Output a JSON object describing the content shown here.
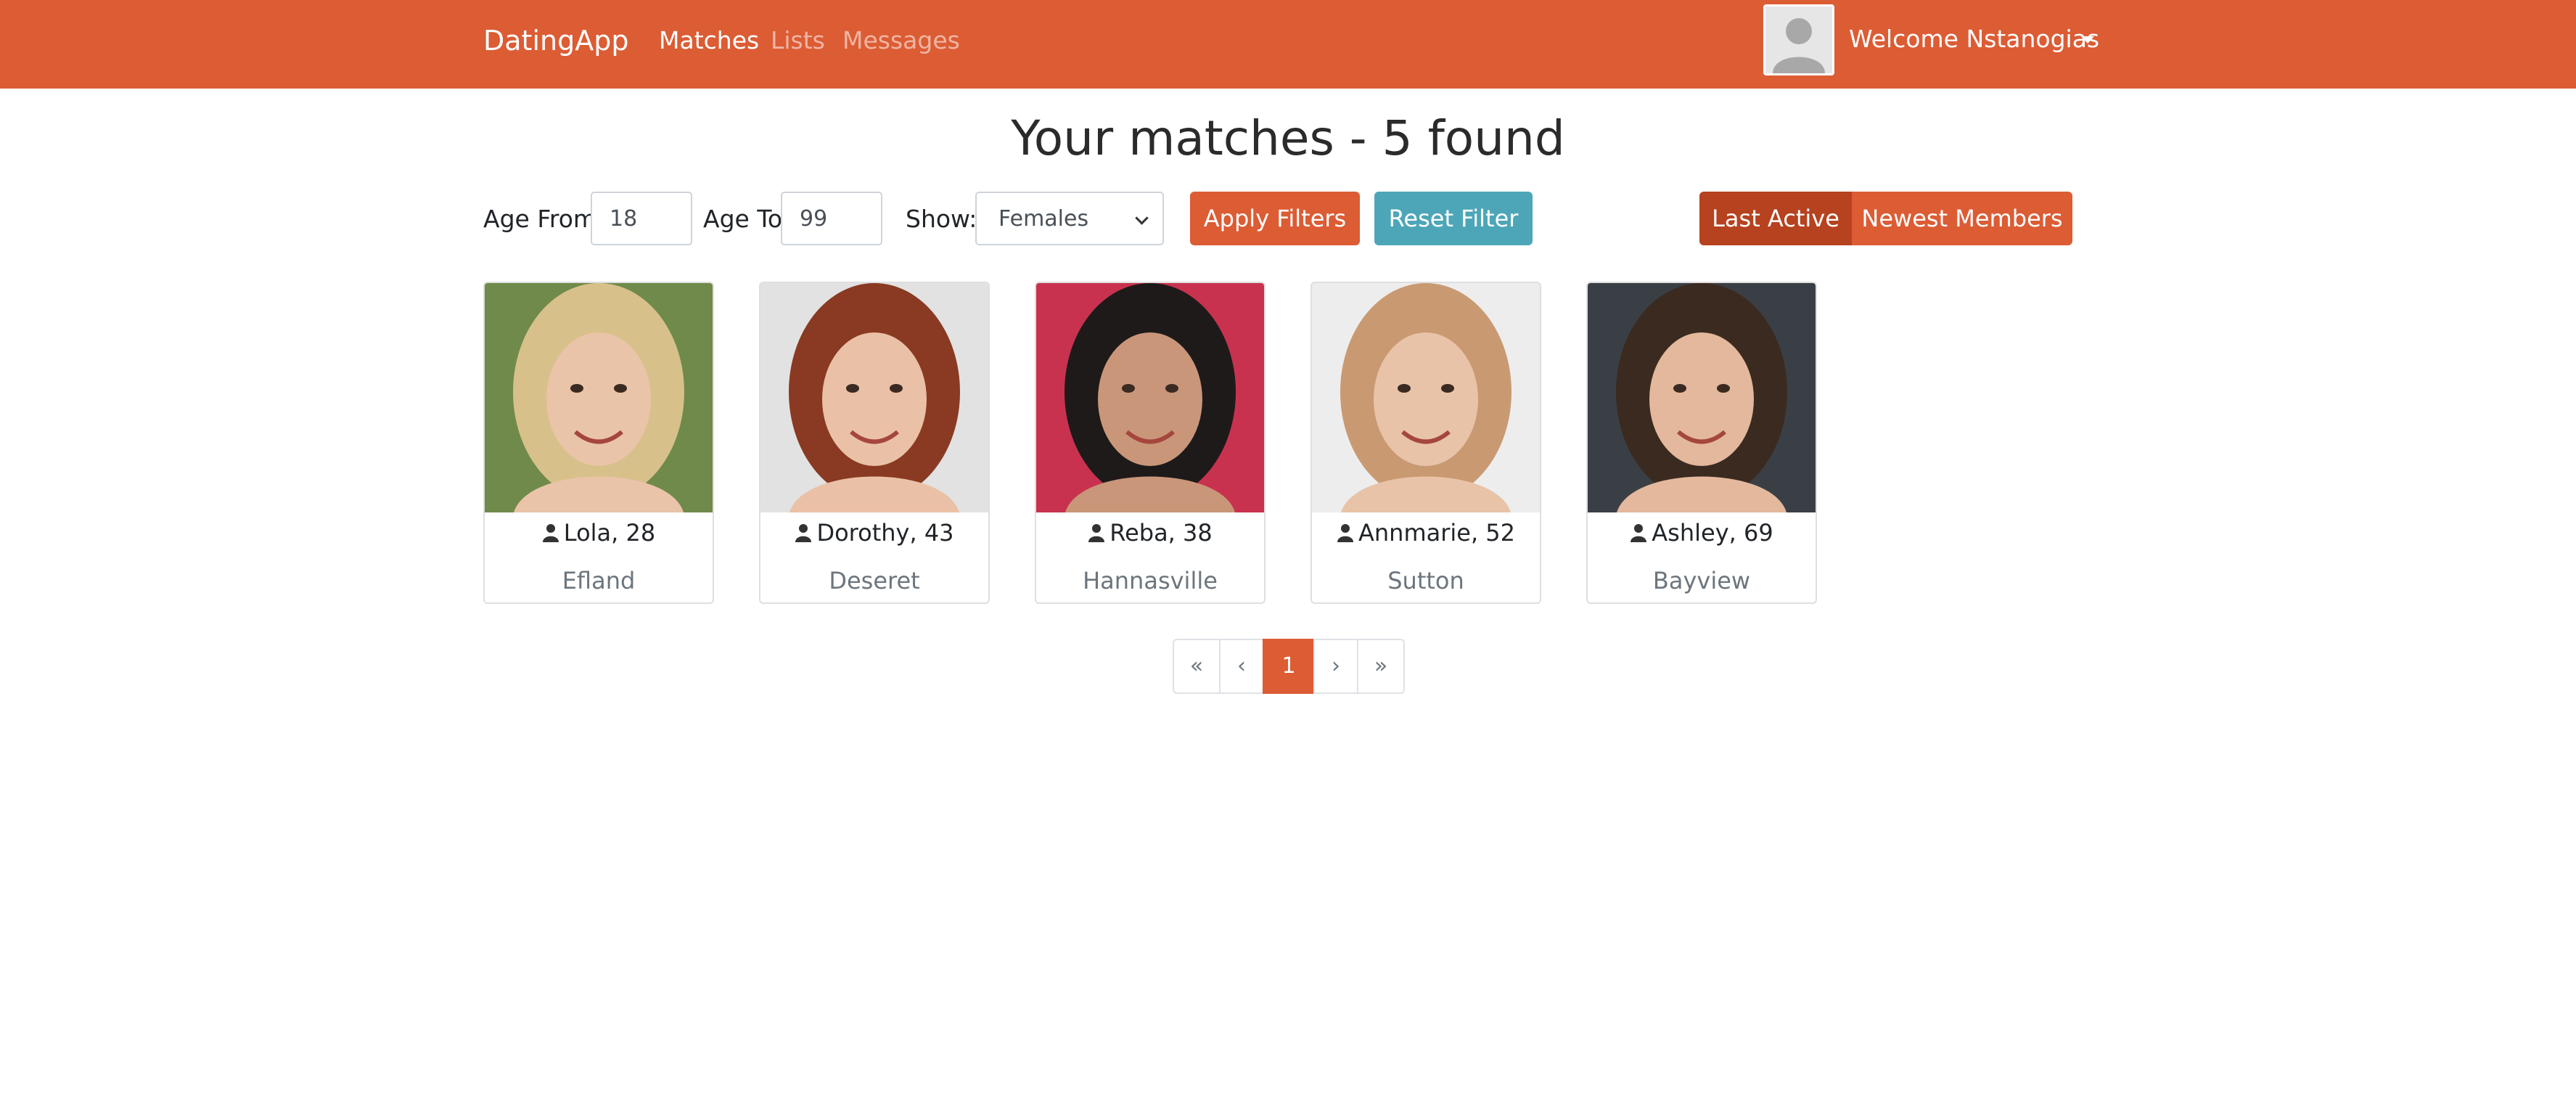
{
  "navbar": {
    "brand": "DatingApp",
    "links": [
      "Matches",
      "Lists",
      "Messages"
    ],
    "welcome": "Welcome Nstanogias"
  },
  "title": "Your matches - 5 found",
  "filters": {
    "age_from_label": "Age From",
    "age_from_value": "18",
    "age_to_label": "Age To",
    "age_to_value": "99",
    "show_label": "Show:",
    "show_value": "Females",
    "apply_label": "Apply Filters",
    "reset_label": "Reset Filter",
    "sort_last_active": "Last Active",
    "sort_newest": "Newest Members"
  },
  "cards": [
    {
      "name": "Lola, 28",
      "city": "Efland",
      "bg": "#6f8a4a",
      "hair": "#d8c08a",
      "skin": "#e9c4a8"
    },
    {
      "name": "Dorothy, 43",
      "city": "Deseret",
      "bg": "#e2e2e2",
      "hair": "#8a3a22",
      "skin": "#eac1a6"
    },
    {
      "name": "Reba, 38",
      "city": "Hannasville",
      "bg": "#c8324e",
      "hair": "#1e1a1a",
      "skin": "#c9967a"
    },
    {
      "name": "Annmarie, 52",
      "city": "Sutton",
      "bg": "#ededed",
      "hair": "#c99a72",
      "skin": "#e8c3a8"
    },
    {
      "name": "Ashley, 69",
      "city": "Bayview",
      "bg": "#3a3f45",
      "hair": "#3b2a20",
      "skin": "#e3b89c"
    }
  ],
  "pagination": [
    "«",
    "‹",
    "1",
    "›",
    "»"
  ],
  "colors": {
    "accent": "#dc5c34",
    "info": "#4da6b8",
    "accent_dark": "#b6421f"
  }
}
